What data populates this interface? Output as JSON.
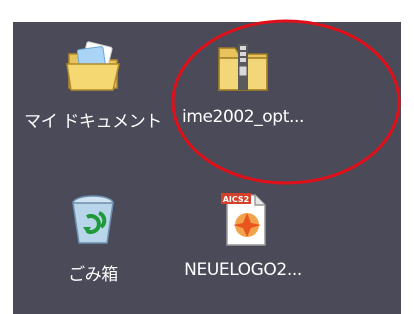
{
  "desktop": {
    "icons": [
      {
        "label": "マイ ドキュメント",
        "icon": "my-documents-folder-icon"
      },
      {
        "label": "ime2002_opt...",
        "icon": "zip-folder-icon"
      },
      {
        "label": "ごみ箱",
        "icon": "recycle-bin-icon"
      },
      {
        "label": "NEUELOGO2...",
        "icon": "ai-cs2-file-icon"
      }
    ],
    "file_badge": "AICS2"
  },
  "colors": {
    "desktop_background": "#4b4a58",
    "annotation": "#e0101a",
    "label_text": "#ffffff"
  }
}
